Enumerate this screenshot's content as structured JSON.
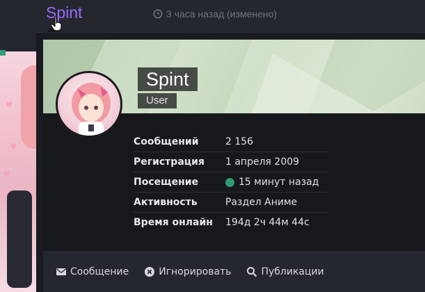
{
  "header": {
    "username": "Spint",
    "post_time": "3 часа назад (изменено)"
  },
  "profile": {
    "name": "Spint",
    "role": "User"
  },
  "stats": [
    {
      "label": "Сообщений",
      "value": "2 156"
    },
    {
      "label": "Регистрация",
      "value": "1 апреля 2009"
    },
    {
      "label": "Посещение",
      "value": "15 минут назад",
      "status": "online"
    },
    {
      "label": "Активность",
      "value": "Раздел Аниме"
    },
    {
      "label": "Время онлайн",
      "value": "194д 2ч 44м 44с"
    }
  ],
  "actions": {
    "message": "Сообщение",
    "ignore": "Игнорировать",
    "publications": "Публикации"
  },
  "colors": {
    "username": "#9b6bff",
    "online": "#2d9c6e",
    "tooltip_bg": "#1a1b20",
    "footer_bg": "#25272e"
  },
  "icons": {
    "post_time": "clock-icon",
    "message": "envelope-icon",
    "ignore": "times-circle-icon",
    "publications": "search-icon"
  }
}
